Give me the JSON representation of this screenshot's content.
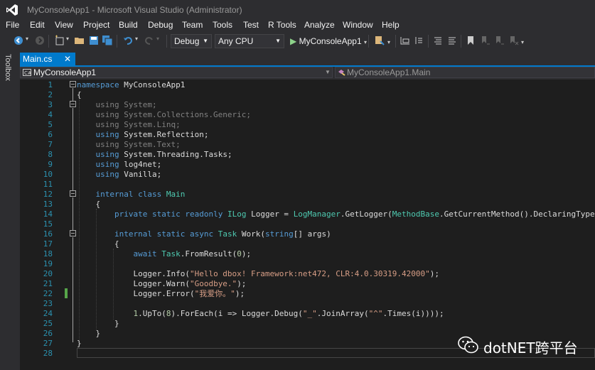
{
  "window": {
    "title": "MyConsoleApp1 - Microsoft Visual Studio (Administrator)"
  },
  "menu": [
    "File",
    "Edit",
    "View",
    "Project",
    "Build",
    "Debug",
    "Team",
    "Tools",
    "Test",
    "R Tools",
    "Analyze",
    "Window",
    "Help"
  ],
  "toolbar": {
    "configuration": "Debug",
    "platform": "Any CPU",
    "start_label": "MyConsoleApp1"
  },
  "toolbox": {
    "label": "Toolbox"
  },
  "tab": {
    "label": "Main.cs",
    "close": "✕"
  },
  "navbar": {
    "project": "MyConsoleApp1",
    "member": "MyConsoleApp1.Main"
  },
  "colors": {
    "accent": "#007acc",
    "keyword": "#569cd6",
    "type": "#4ec9b0",
    "string": "#d69d85",
    "line_number": "#2b91af",
    "change_bar": "#57a64a"
  },
  "code": {
    "line_numbers": [
      "1",
      "2",
      "3",
      "4",
      "5",
      "6",
      "7",
      "8",
      "9",
      "10",
      "11",
      "12",
      "13",
      "14",
      "15",
      "16",
      "17",
      "18",
      "19",
      "20",
      "21",
      "22",
      "23",
      "24",
      "25",
      "26",
      "27",
      "28"
    ],
    "lines": [
      "namespace MyConsoleApp1",
      "{",
      "    using System;",
      "    using System.Collections.Generic;",
      "    using System.Linq;",
      "    using System.Reflection;",
      "    using System.Text;",
      "    using System.Threading.Tasks;",
      "    using log4net;",
      "    using Vanilla;",
      "",
      "    internal class Main",
      "    {",
      "        private static readonly ILog Logger = LogManager.GetLogger(MethodBase.GetCurrentMethod().DeclaringType);",
      "",
      "        internal static async Task Work(string[] args)",
      "        {",
      "            await Task.FromResult(0);",
      "",
      "            Logger.Info(\"Hello dbox! Framework:net472, CLR:4.0.30319.42000\");",
      "            Logger.Warn(\"Goodbye.\");",
      "            Logger.Error(\"我爱你。\");",
      "",
      "            1.UpTo(8).ForEach(i => Logger.Debug(\"_\".JoinArray(\"^\".Times(i))));",
      "        }",
      "    }",
      "}",
      ""
    ]
  },
  "watermark": {
    "text": "dotNET跨平台"
  }
}
